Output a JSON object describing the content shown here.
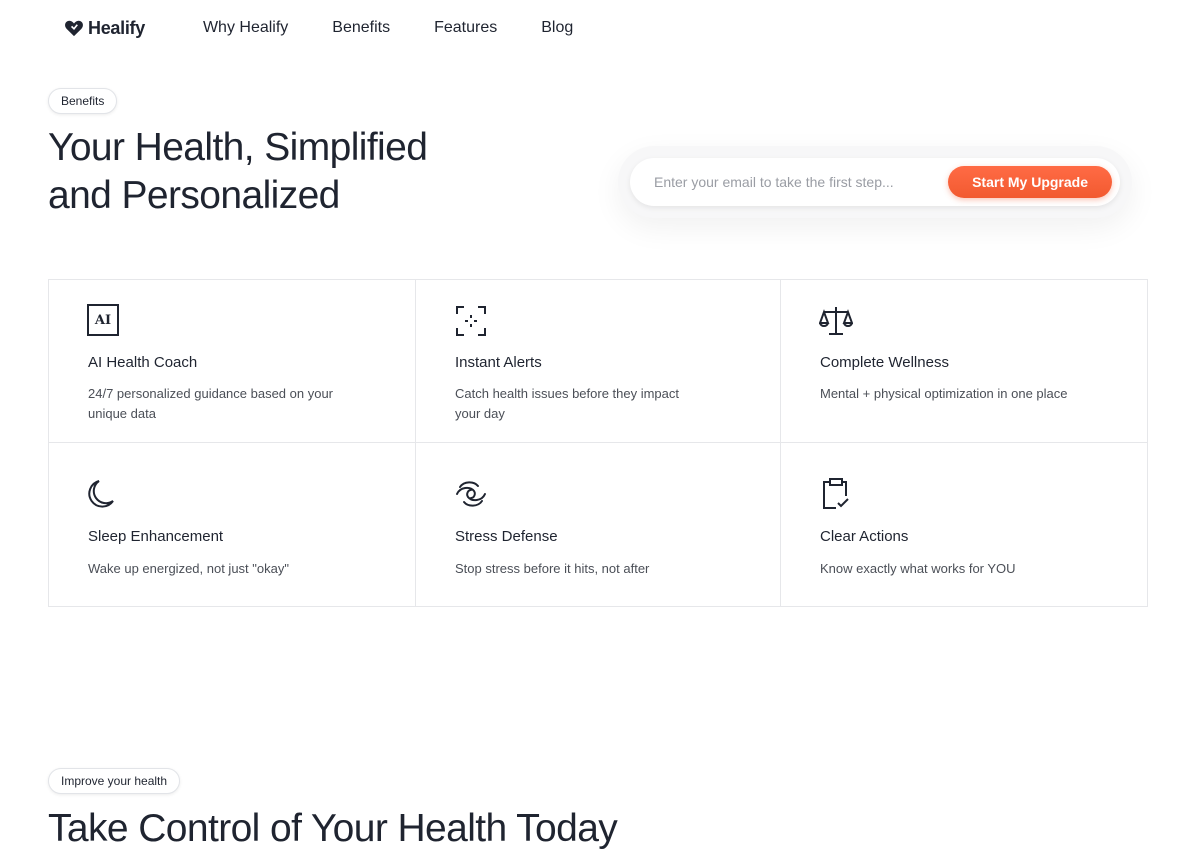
{
  "brand": {
    "name": "Healify"
  },
  "nav": {
    "items": [
      "Why Healify",
      "Benefits",
      "Features",
      "Blog"
    ]
  },
  "hero": {
    "pill": "Benefits",
    "title_line1": "Your Health, Simplified",
    "title_line2": "and Personalized",
    "email_placeholder": "Enter your email to take the first step...",
    "cta_label": "Start My Upgrade"
  },
  "features": [
    {
      "icon": "ai-icon",
      "icon_text": "AI",
      "title": "AI Health Coach",
      "desc": "24/7 personalized guidance based on your unique data"
    },
    {
      "icon": "focus-alert-icon",
      "title": "Instant Alerts",
      "desc": "Catch health issues before they impact your day"
    },
    {
      "icon": "scale-balance-icon",
      "title": "Complete Wellness",
      "desc": "Mental + physical optimization in one place"
    },
    {
      "icon": "moon-icon",
      "title": "Sleep Enhancement",
      "desc": "Wake up energized, not just \"okay\""
    },
    {
      "icon": "swirl-icon",
      "title": "Stress Defense",
      "desc": "Stop stress before it hits, not after"
    },
    {
      "icon": "clipboard-check-icon",
      "title": "Clear Actions",
      "desc": "Know exactly what works for YOU"
    }
  ],
  "section2": {
    "pill": "Improve your health",
    "title": "Take Control of Your Health Today"
  },
  "colors": {
    "accent": "#f25a30",
    "text": "#1f2430",
    "border": "#e6e7ea"
  }
}
